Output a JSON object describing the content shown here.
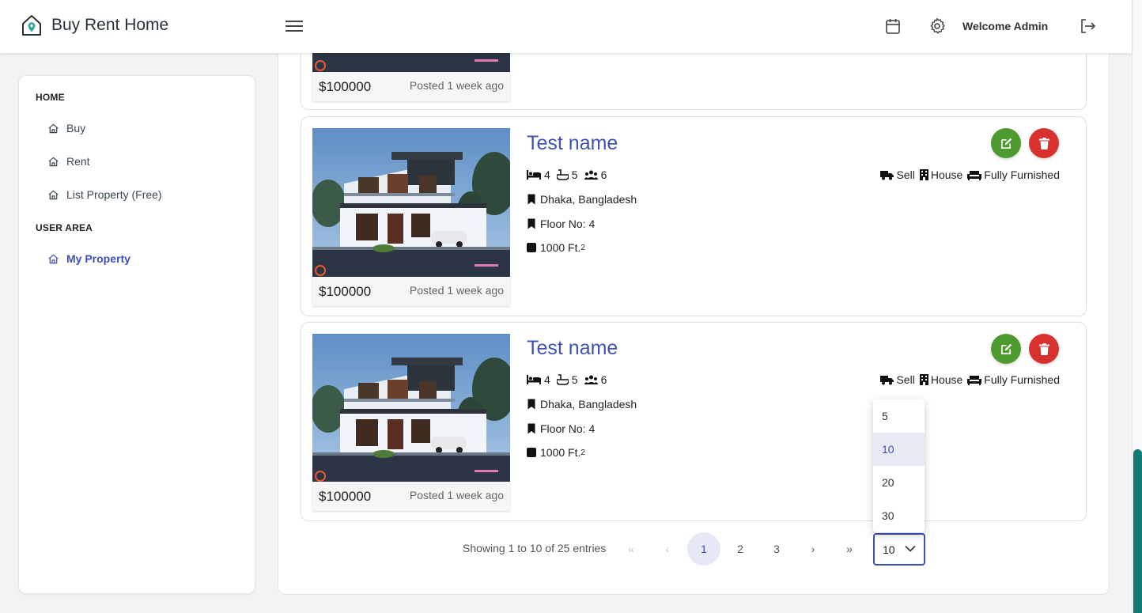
{
  "header": {
    "brand": "Buy Rent Home",
    "welcome": "Welcome Admin"
  },
  "sidebar": {
    "sections": [
      {
        "title": "HOME",
        "items": [
          {
            "label": "Buy"
          },
          {
            "label": "Rent"
          },
          {
            "label": "List Property (Free)"
          }
        ]
      },
      {
        "title": "USER AREA",
        "items": [
          {
            "label": "My Property"
          }
        ]
      }
    ]
  },
  "listings": [
    {
      "title": "Test name",
      "price": "$100000",
      "posted": "Posted 1 week ago",
      "beds": "4",
      "baths": "5",
      "guests": "6",
      "location": "Dhaka, Bangladesh",
      "floor": "Floor No: 4",
      "area": "1000 Ft.",
      "area_sup": "2",
      "deal": "Sell",
      "kind": "House",
      "furnish": "Fully Furnished"
    },
    {
      "title": "Test name",
      "price": "$100000",
      "posted": "Posted 1 week ago",
      "beds": "4",
      "baths": "5",
      "guests": "6",
      "location": "Dhaka, Bangladesh",
      "floor": "Floor No: 4",
      "area": "1000 Ft.",
      "area_sup": "2",
      "deal": "Sell",
      "kind": "House",
      "furnish": "Fully Furnished"
    },
    {
      "price": "$100000",
      "posted": "Posted 1 week ago"
    }
  ],
  "pagination": {
    "summary": "Showing 1 to 10 of 25 entries",
    "pages": [
      "1",
      "2",
      "3"
    ],
    "current_page": "1",
    "first": "«",
    "prev": "‹",
    "next": "›",
    "last": "»",
    "page_size": "10",
    "page_size_options": [
      "5",
      "10",
      "20",
      "30"
    ]
  },
  "colors": {
    "accent": "#3f51b5",
    "edit": "#4e9a2f",
    "delete": "#d8312f",
    "scroll": "#117a74"
  },
  "icons": [
    "home-logo-icon",
    "hamburger-icon",
    "calendar-icon",
    "gear-icon",
    "logout-icon",
    "home-icon",
    "bed-icon",
    "bath-icon",
    "people-icon",
    "bookmark-icon",
    "square-icon",
    "truck-icon",
    "building-icon",
    "sofa-icon",
    "edit-icon",
    "trash-icon",
    "chevron-down-icon"
  ]
}
